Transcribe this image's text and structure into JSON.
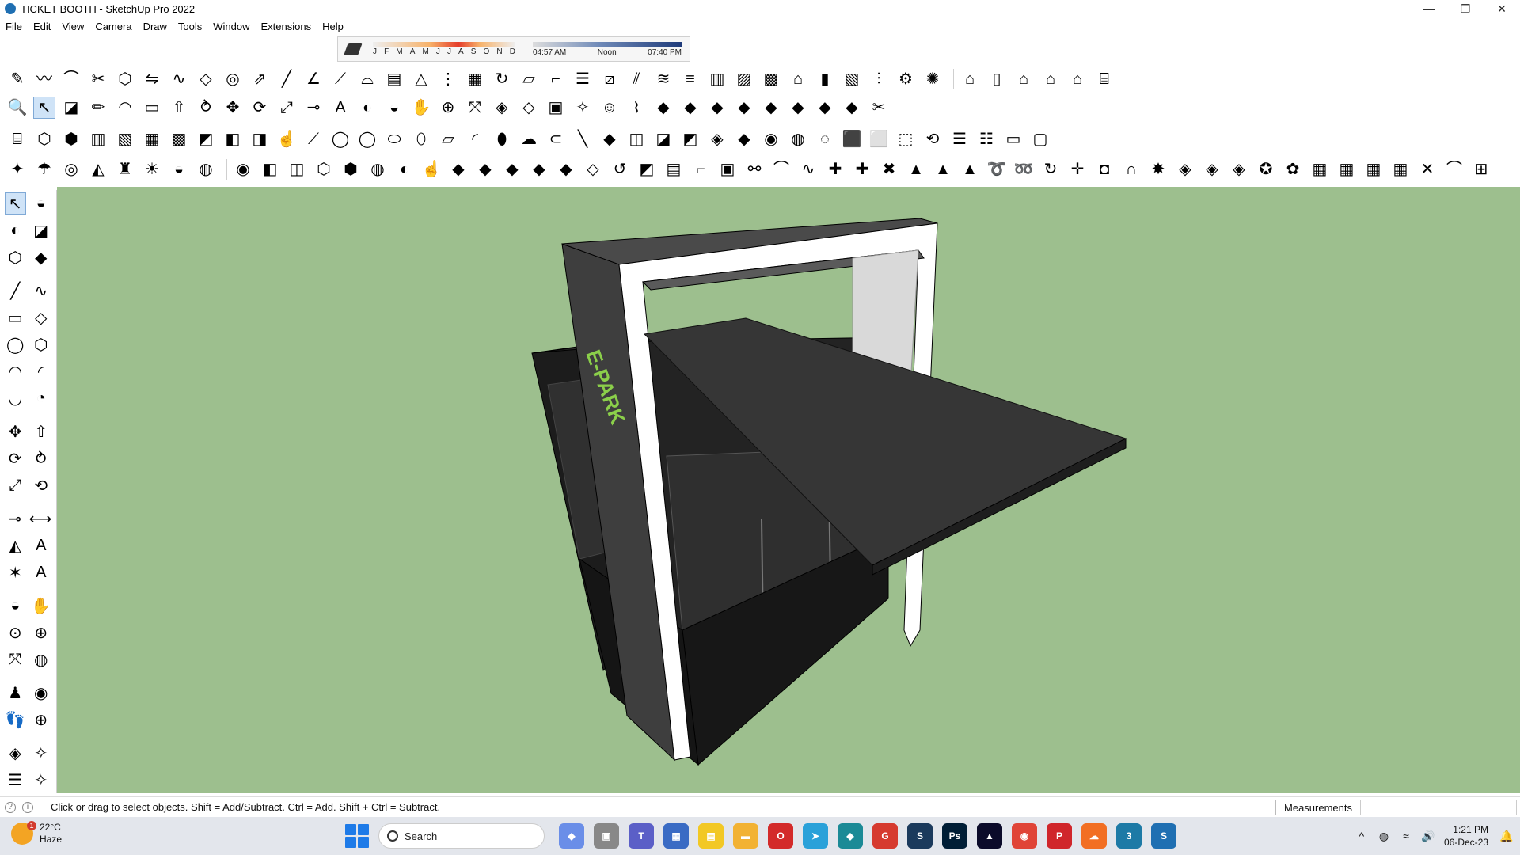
{
  "window": {
    "title": "TICKET BOOTH - SketchUp Pro 2022",
    "controls": {
      "minimize": "—",
      "maximize": "❐",
      "close": "✕"
    }
  },
  "menu": [
    "File",
    "Edit",
    "View",
    "Camera",
    "Draw",
    "Tools",
    "Window",
    "Extensions",
    "Help"
  ],
  "shadows": {
    "months": [
      "J",
      "F",
      "M",
      "A",
      "M",
      "J",
      "J",
      "A",
      "S",
      "O",
      "N",
      "D"
    ],
    "sunrise": "04:57 AM",
    "noon": "Noon",
    "sunset": "07:40 PM"
  },
  "model": {
    "sign_text": "E-PARK",
    "colors": {
      "background": "#9dbf8e",
      "body": "#2c2c2c",
      "roof_top": "#3a3a3a",
      "frame": "#4a4a4a",
      "frame_inner": "#ffffff",
      "sign": "#8bcf4a"
    }
  },
  "status": {
    "hint": "Click or drag to select objects. Shift = Add/Subtract. Ctrl = Add. Shift + Ctrl = Subtract.",
    "measurements_label": "Measurements",
    "measurements_value": ""
  },
  "taskbar": {
    "weather_temp": "22°C",
    "weather_desc": "Haze",
    "weather_badge": "1",
    "search_placeholder": "Search",
    "time": "1:21 PM",
    "date": "06-Dec-23"
  }
}
